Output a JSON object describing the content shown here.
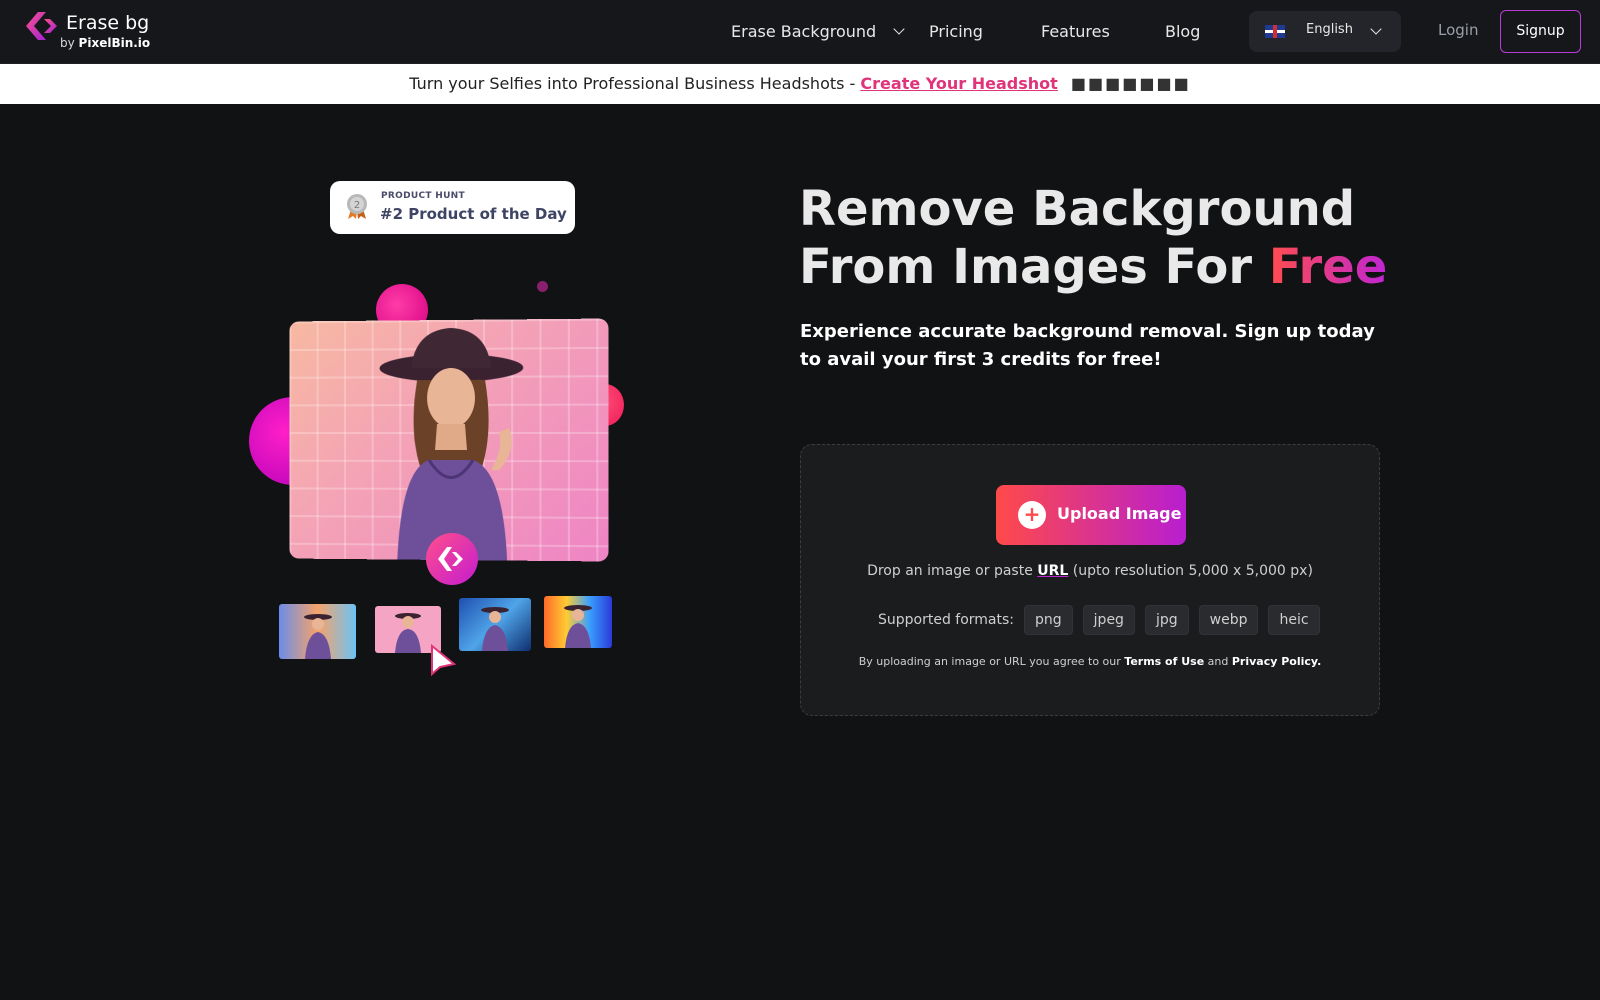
{
  "header": {
    "logo_title": "Erase bg",
    "logo_by": "by",
    "logo_brand": "PixelBin.io",
    "nav": [
      {
        "label": "Erase Background",
        "has_dropdown": true
      },
      {
        "label": "Pricing"
      },
      {
        "label": "Features"
      },
      {
        "label": "Blog"
      }
    ],
    "language": "English",
    "login": "Login",
    "signup": "Signup"
  },
  "promo": {
    "text": "Turn your Selfies into Professional Business Headshots -",
    "link": "Create Your Headshot",
    "emoji_glyphs": "■■■■■■■"
  },
  "badge": {
    "small": "PRODUCT HUNT",
    "big": "#2 Product of the Day",
    "medal_number": "2"
  },
  "hero": {
    "title_line1": "Remove Background",
    "title_line2_pre": "From Images For",
    "title_free": "Free",
    "subtitle": "Experience accurate background removal. Sign up today to avail your first 3 credits for free!"
  },
  "upload": {
    "button_label": "Upload Image",
    "button_icon": "plus-icon",
    "hint_pre": "Drop an image or paste",
    "hint_url": "URL",
    "hint_post": "(upto resolution 5,000 x 5,000 px)",
    "formats_label": "Supported formats:",
    "formats": [
      "png",
      "jpeg",
      "jpg",
      "webp",
      "heic"
    ],
    "terms_pre": "By uploading an image or URL you agree to our",
    "terms_link": "Terms of Use",
    "terms_and": "and",
    "privacy_link": "Privacy Policy."
  },
  "colors": {
    "background": "#111214",
    "header": "#16171a",
    "accent_red": "#ff4a4a",
    "accent_purple": "#b81ed0",
    "link_pink": "#e0347a"
  }
}
